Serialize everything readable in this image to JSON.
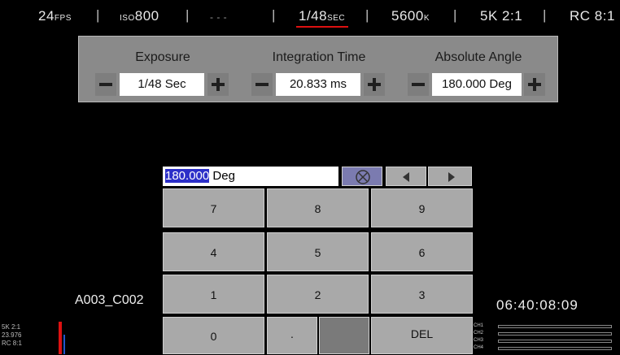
{
  "status_bar": {
    "fps": "24",
    "fps_unit": "FPS",
    "iso_prefix": "ISO",
    "iso_value": "800",
    "dashes": "- - -",
    "shutter": "1/48",
    "shutter_unit": "SEC",
    "kelvin": "5600",
    "kelvin_unit": "K",
    "resolution": "5K 2:1",
    "compression": "RC 8:1",
    "separator": "|"
  },
  "settings": {
    "exposure": {
      "label": "Exposure",
      "value": "1/48 Sec"
    },
    "integration_time": {
      "label": "Integration Time",
      "value": "20.833 ms"
    },
    "absolute_angle": {
      "label": "Absolute Angle",
      "value": "180.000 Deg"
    }
  },
  "keypad": {
    "entry_selected": "180.000",
    "entry_unit": " Deg",
    "keys": [
      "7",
      "8",
      "9",
      "4",
      "5",
      "6",
      "1",
      "2",
      "3"
    ],
    "zero": "0",
    "dot": ".",
    "del": "DEL"
  },
  "clip_name": "A003_C002",
  "timecode": "06:40:08:09",
  "bottom_left": {
    "line1": "5K 2:1",
    "line2": "23.976",
    "line3": "RC 8:1"
  },
  "audio_channels": [
    "CH1",
    "CH2",
    "CH3",
    "CH4"
  ],
  "colors": {
    "accent_red": "#d11",
    "panel_gray": "#8a8a8a",
    "highlight_blue": "#2c2fc8"
  }
}
